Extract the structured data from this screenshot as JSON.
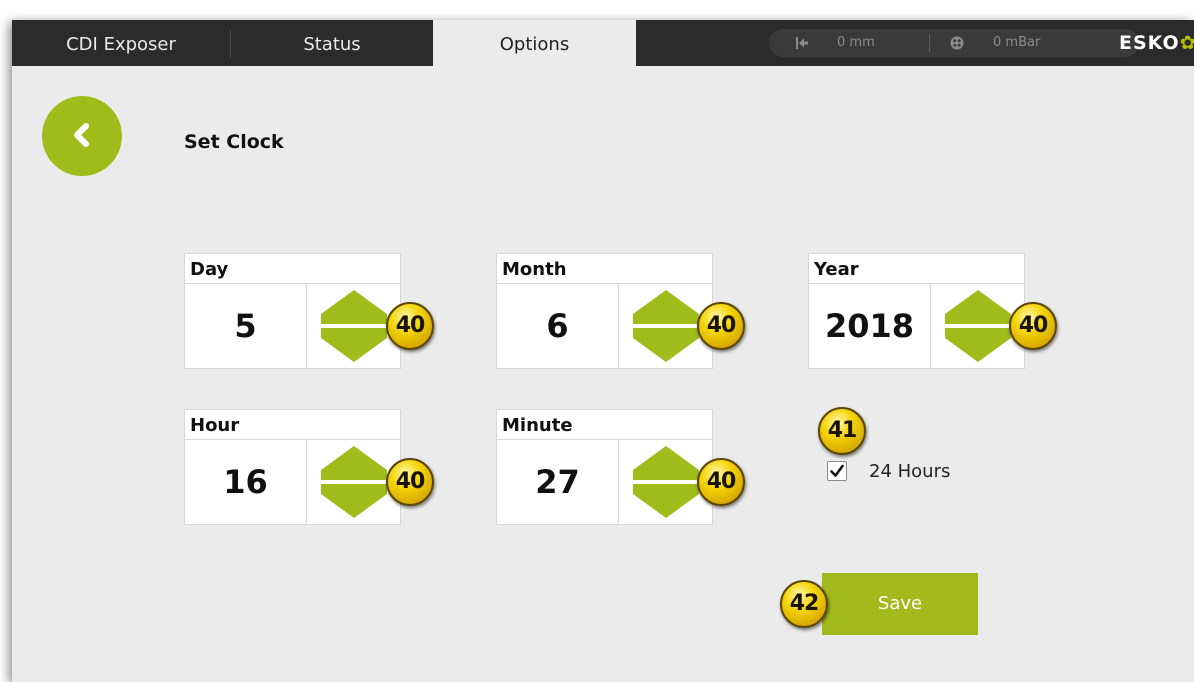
{
  "tabs": [
    {
      "label": "CDI Exposer",
      "active": false
    },
    {
      "label": "Status",
      "active": false
    },
    {
      "label": "Options",
      "active": true
    }
  ],
  "status": {
    "distance": "0 mm",
    "distance_icon": "arrow-to-left-icon",
    "pressure": "0 mBar",
    "pressure_icon": "vacuum-icon"
  },
  "logo": {
    "text": "ESKO"
  },
  "page": {
    "title": "Set Clock",
    "back_icon": "chevron-left-icon"
  },
  "fields": {
    "day": {
      "label": "Day",
      "value": "5"
    },
    "month": {
      "label": "Month",
      "value": "6"
    },
    "year": {
      "label": "Year",
      "value": "2018"
    },
    "hour": {
      "label": "Hour",
      "value": "16"
    },
    "minute": {
      "label": "Minute",
      "value": "27"
    }
  },
  "checkbox_24h": {
    "label": "24 Hours",
    "checked": true
  },
  "save": {
    "label": "Save"
  },
  "badges": {
    "stepper": "40",
    "checkbox": "41",
    "save": "42"
  },
  "colors": {
    "accent_green": "#a3ba1c",
    "topbar": "#2b2b2b",
    "background": "#ebebeb",
    "badge_yellow": "#f5d60a"
  }
}
